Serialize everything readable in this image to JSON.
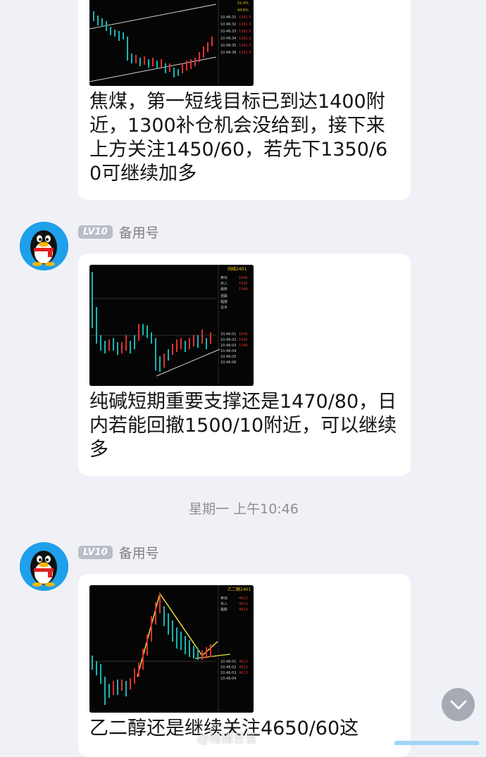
{
  "messages": [
    {
      "text": "焦煤，第一短线目标已到达1400附近，1300补仓机会没给到，接下来上方关注1450/60，若先下1350/60可继续加多"
    },
    {
      "sender": {
        "level": "LV10",
        "name": "备用号"
      },
      "text": "纯碱短期重要支撑还是1470/80，日内若能回撤1500/10附近，可以继续多"
    },
    {
      "sender": {
        "level": "LV10",
        "name": "备用号"
      },
      "text": "乙二醇还是继续关注4650/60这"
    }
  ],
  "time_divider": "星期一 上午10:46",
  "watermark": "@猪猪苦苦",
  "colors": {
    "background": "#f0f1f6",
    "bubble": "#ffffff",
    "avatar_bg": "#1fa0ea",
    "level_badge": "#b8bdc8"
  },
  "icons": {
    "avatar": "qq-penguin-icon",
    "scroll": "chevron-down-icon"
  }
}
